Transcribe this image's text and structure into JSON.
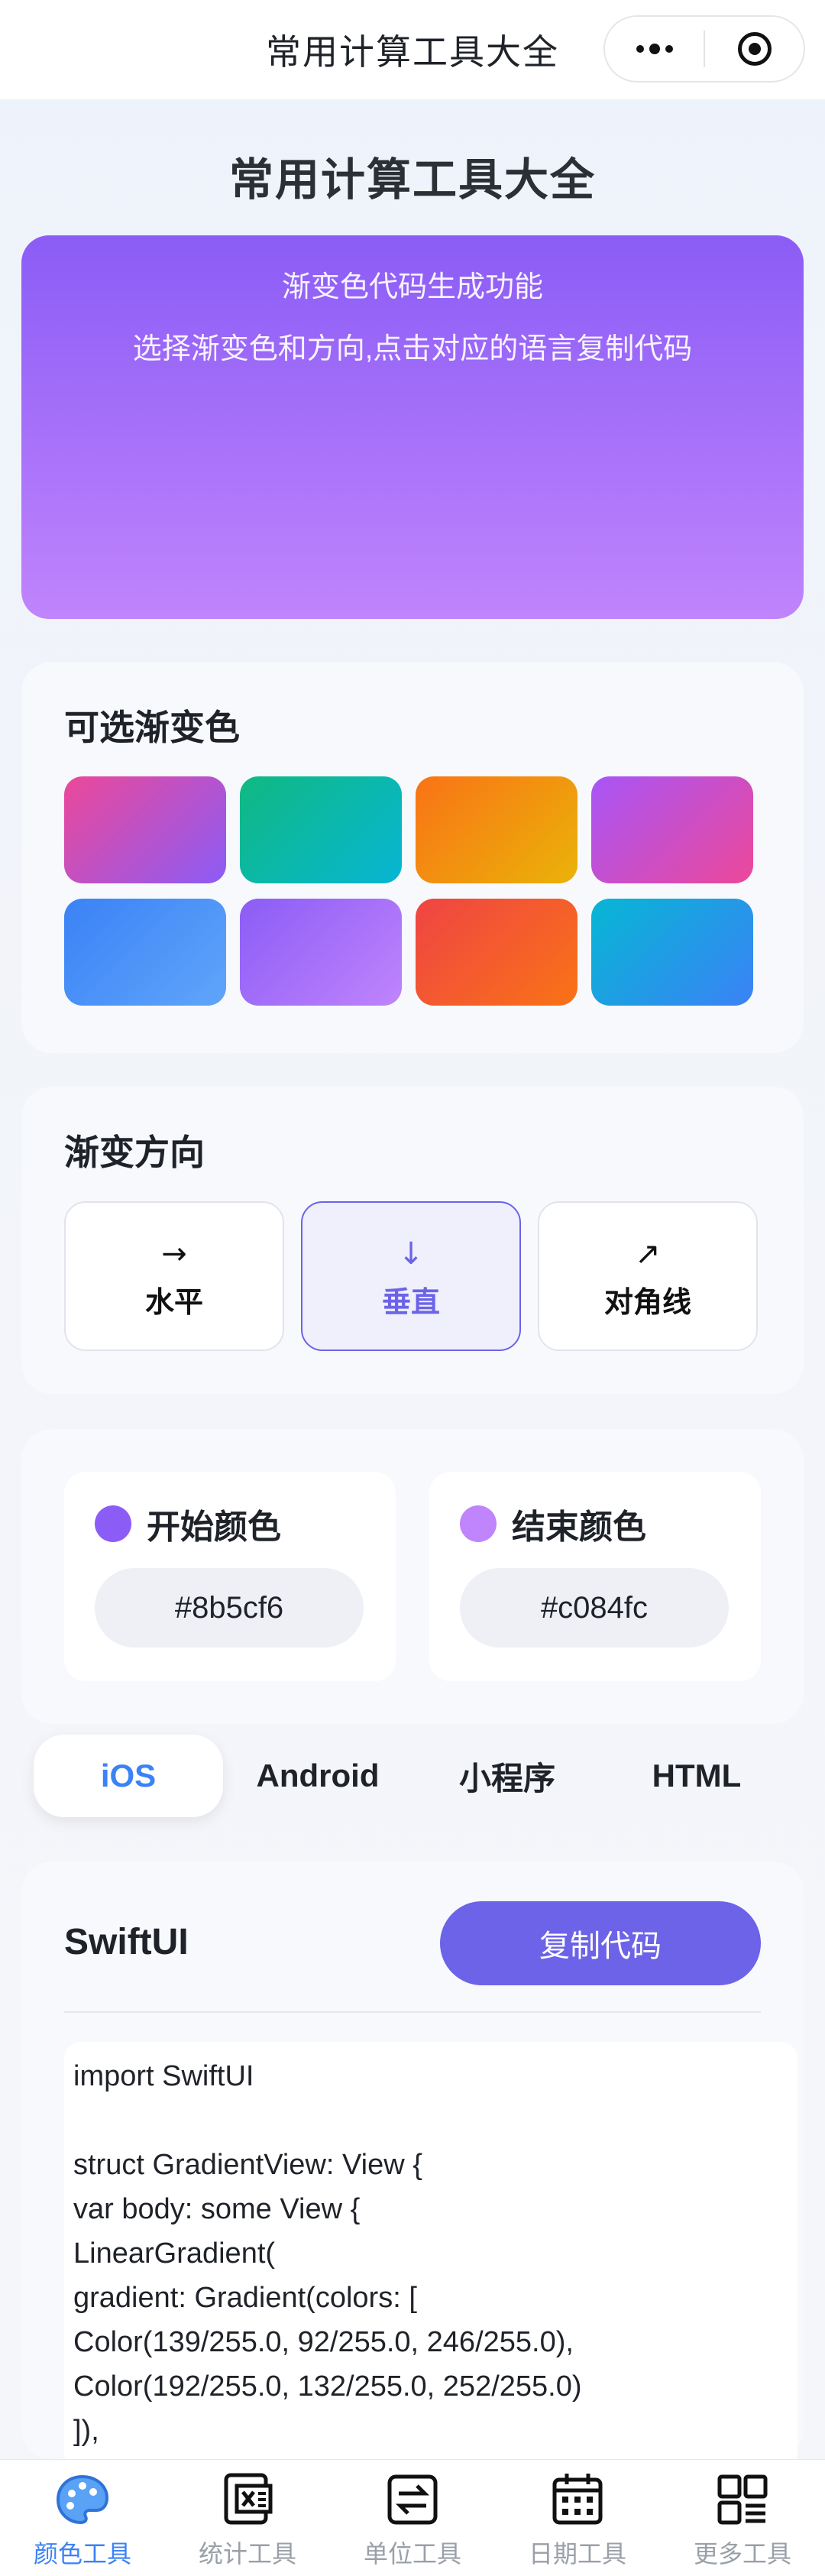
{
  "navbar": {
    "title": "常用计算工具大全"
  },
  "page_title": "常用计算工具大全",
  "preview": {
    "line1": "渐变色代码生成功能",
    "line2": "选择渐变色和方向,点击对应的语言复制代码",
    "start_color": "#8b5cf6",
    "end_color": "#c084fc"
  },
  "swatches_section": {
    "title": "可选渐变色",
    "swatches": [
      {
        "from": "#ec4899",
        "to": "#8b5cf6"
      },
      {
        "from": "#10b981",
        "to": "#06b6d4"
      },
      {
        "from": "#f97316",
        "to": "#eab308"
      },
      {
        "from": "#a855f7",
        "to": "#ec4899"
      },
      {
        "from": "#3b82f6",
        "to": "#60a5fa"
      },
      {
        "from": "#8b5cf6",
        "to": "#c084fc"
      },
      {
        "from": "#ef4444",
        "to": "#f97316"
      },
      {
        "from": "#06b6d4",
        "to": "#3b82f6"
      }
    ]
  },
  "direction_section": {
    "title": "渐变方向",
    "options": [
      {
        "icon": "arrow-right-icon",
        "arrow": "→",
        "label": "水平"
      },
      {
        "icon": "arrow-down-icon",
        "arrow": "↓",
        "label": "垂直"
      },
      {
        "icon": "arrow-up-right-icon",
        "arrow": "↗",
        "label": "对角线"
      }
    ],
    "selected": "垂直"
  },
  "colors_section": {
    "start": {
      "label": "开始颜色",
      "value": "#8b5cf6"
    },
    "end": {
      "label": "结束颜色",
      "value": "#c084fc"
    }
  },
  "language_tabs": {
    "items": [
      "iOS",
      "Android",
      "小程序",
      "HTML"
    ],
    "selected": "iOS"
  },
  "code_section": {
    "title": "SwiftUI",
    "copy_label": "复制代码",
    "code": "import SwiftUI\n\nstruct GradientView: View {\nvar body: some View {\nLinearGradient(\ngradient: Gradient(colors: [\nColor(139/255.0, 92/255.0, 246/255.0),\nColor(192/255.0, 132/255.0, 252/255.0)\n]),"
  },
  "tabbar": {
    "items": [
      {
        "label": "颜色工具",
        "icon": "palette-icon",
        "active": true
      },
      {
        "label": "统计工具",
        "icon": "excel-icon",
        "active": false
      },
      {
        "label": "单位工具",
        "icon": "convert-icon",
        "active": false
      },
      {
        "label": "日期工具",
        "icon": "calendar-icon",
        "active": false
      },
      {
        "label": "更多工具",
        "icon": "grid-icon",
        "active": false
      }
    ]
  },
  "colors": {
    "accent": "#6c63e8",
    "tab_active": "#3b82f6"
  }
}
